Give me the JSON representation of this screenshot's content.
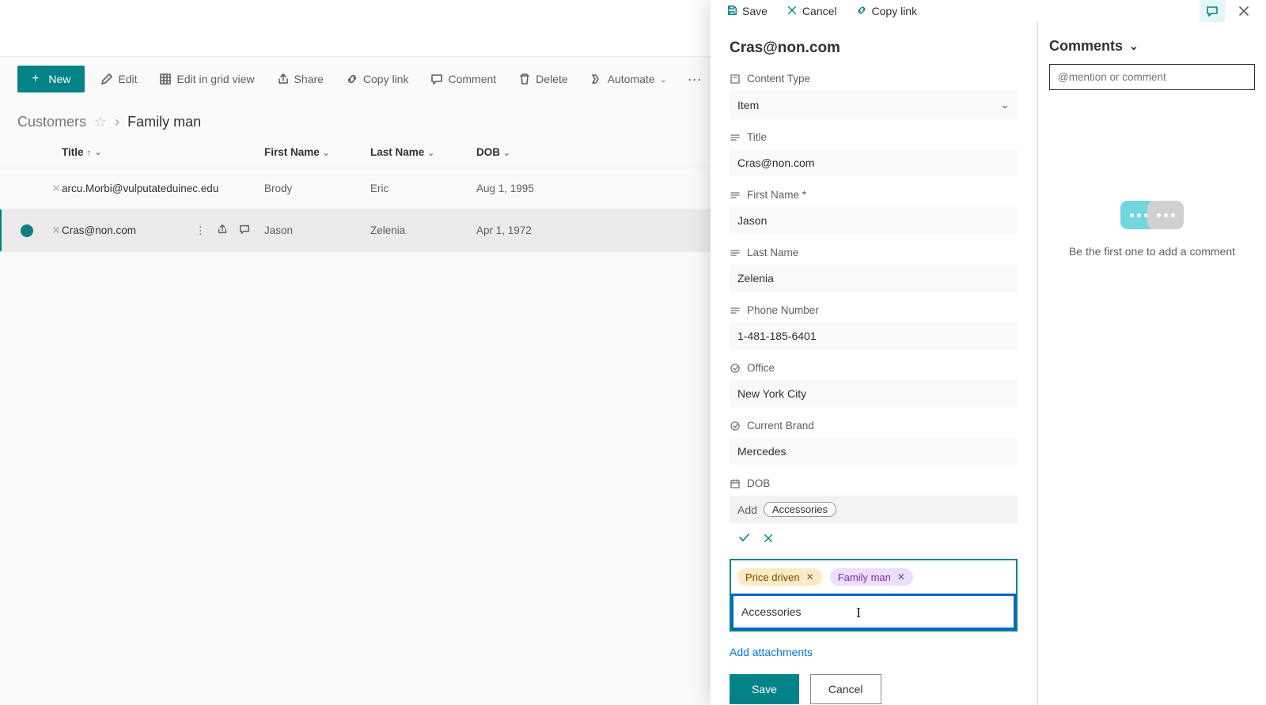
{
  "toolbar": {
    "new": "New",
    "edit": "Edit",
    "grid_view": "Edit in grid view",
    "share": "Share",
    "copy_link": "Copy link",
    "comment": "Comment",
    "delete": "Delete",
    "automate": "Automate"
  },
  "breadcrumb": {
    "root": "Customers",
    "current": "Family man"
  },
  "grid": {
    "columns": {
      "title": "Title",
      "first_name": "First Name",
      "last_name": "Last Name",
      "dob": "DOB"
    },
    "rows": [
      {
        "title": "arcu.Morbi@vulputateduinec.edu",
        "first_name": "Brody",
        "last_name": "Eric",
        "dob": "Aug 1, 1995",
        "selected": false
      },
      {
        "title": "Cras@non.com",
        "first_name": "Jason",
        "last_name": "Zelenia",
        "dob": "Apr 1, 1972",
        "selected": true
      }
    ]
  },
  "panel": {
    "actions": {
      "save": "Save",
      "cancel": "Cancel",
      "copy_link": "Copy link"
    },
    "title": "Cras@non.com",
    "fields": {
      "content_type": {
        "label": "Content Type",
        "value": "Item"
      },
      "title": {
        "label": "Title",
        "value": "Cras@non.com"
      },
      "first_name": {
        "label": "First Name *",
        "value": "Jason"
      },
      "last_name": {
        "label": "Last Name",
        "value": "Zelenia"
      },
      "phone": {
        "label": "Phone Number",
        "value": "1-481-185-6401"
      },
      "office": {
        "label": "Office",
        "value": "New York City"
      },
      "current_brand": {
        "label": "Current Brand",
        "value": "Mercedes"
      },
      "dob": {
        "label": "DOB"
      }
    },
    "tag_suggest": {
      "prefix": "Add",
      "suggestion": "Accessories"
    },
    "tags": {
      "pills": [
        {
          "text": "Price driven",
          "color": "yellow"
        },
        {
          "text": "Family man",
          "color": "purple"
        }
      ],
      "input_value": "Accessories"
    },
    "attachments_link": "Add attachments",
    "footer": {
      "save": "Save",
      "cancel": "Cancel"
    }
  },
  "comments": {
    "header": "Comments",
    "input_placeholder": "@mention or comment",
    "empty_text": "Be the first one to add a comment"
  }
}
